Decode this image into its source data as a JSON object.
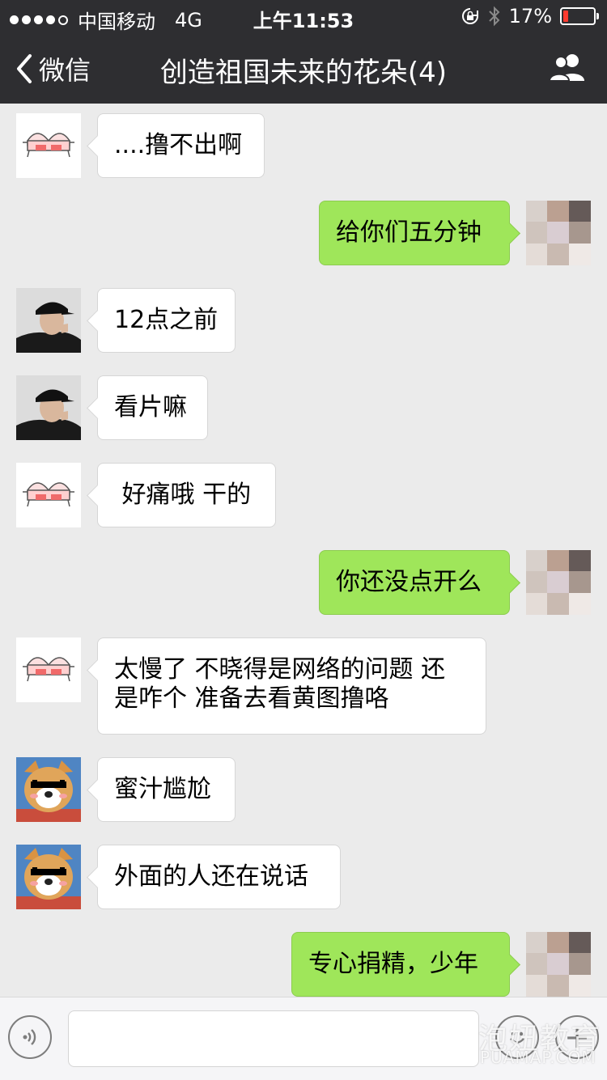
{
  "status_bar": {
    "signal_dots_filled": 4,
    "signal_dots_total": 5,
    "carrier": "中国移动",
    "network": "4G",
    "time": "上午11:53",
    "battery_percent": "17%",
    "battery_level": 0.17,
    "battery_color": "#ff3b30"
  },
  "nav": {
    "back_label": "微信",
    "title": "创造祖国未来的花朵(4)",
    "right_icon": "group-members-icon"
  },
  "messages": [
    {
      "side": "left",
      "avatar": "undies",
      "text": "....撸不出啊"
    },
    {
      "side": "right",
      "avatar": "blurred",
      "text": "给你们五分钟"
    },
    {
      "side": "left",
      "avatar": "boy",
      "text": "12点之前"
    },
    {
      "side": "left",
      "avatar": "boy",
      "text": "看片嘛"
    },
    {
      "side": "left",
      "avatar": "undies",
      "text": " 好痛哦 干的"
    },
    {
      "side": "right",
      "avatar": "blurred",
      "text": "你还没点开么"
    },
    {
      "side": "left",
      "avatar": "undies",
      "text": "太慢了 不晓得是网络的问题 还是咋个 准备去看黄图撸咯"
    },
    {
      "side": "left",
      "avatar": "dog",
      "text": "蜜汁尴尬"
    },
    {
      "side": "left",
      "avatar": "dog",
      "text": "外面的人还在说话"
    },
    {
      "side": "right",
      "avatar": "blurred",
      "text": "专心捐精，少年"
    }
  ],
  "input_bar": {
    "voice_icon": "voice-icon",
    "emoji_icon": "emoji-icon",
    "plus_label": "+"
  },
  "watermark": {
    "cn": "泡妞教育",
    "en": "PUAMAP.COM"
  },
  "colors": {
    "bar": "#2e2e31",
    "chat_bg": "#ebebeb",
    "bubble_self": "#9fe65a",
    "bubble_other": "#ffffff"
  }
}
